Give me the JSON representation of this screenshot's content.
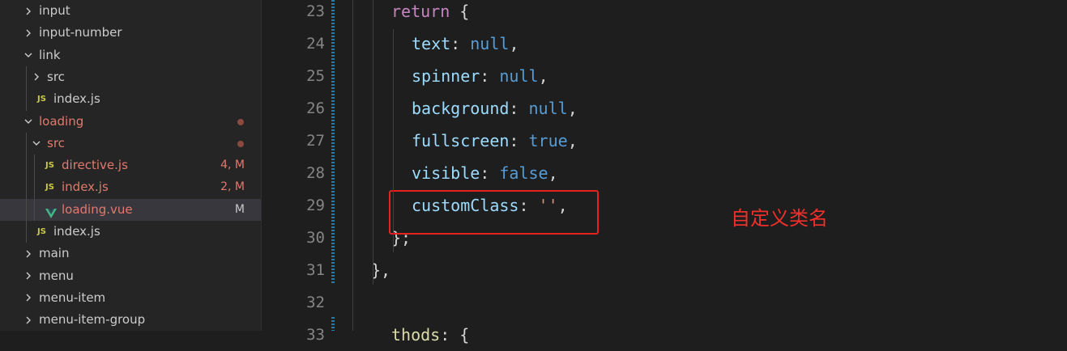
{
  "explorer": {
    "items": [
      {
        "label": "input",
        "kind": "folder",
        "state": "collapsed"
      },
      {
        "label": "input-number",
        "kind": "folder",
        "state": "collapsed"
      },
      {
        "label": "link",
        "kind": "folder",
        "state": "expanded"
      },
      {
        "label": "src",
        "kind": "folder",
        "state": "collapsed"
      },
      {
        "label": "index.js",
        "kind": "js"
      },
      {
        "label": "loading",
        "kind": "folder",
        "state": "expanded",
        "modified": true,
        "dot": true
      },
      {
        "label": "src",
        "kind": "folder",
        "state": "expanded",
        "modified": true,
        "dot": true
      },
      {
        "label": "directive.js",
        "kind": "js",
        "modified": true,
        "badge": "4, M"
      },
      {
        "label": "index.js",
        "kind": "js",
        "modified": true,
        "badge": "2, M"
      },
      {
        "label": "loading.vue",
        "kind": "vue",
        "modified": true,
        "badge": "M",
        "selected": true
      },
      {
        "label": "index.js",
        "kind": "js"
      },
      {
        "label": "main",
        "kind": "folder",
        "state": "collapsed"
      },
      {
        "label": "menu",
        "kind": "folder",
        "state": "collapsed"
      },
      {
        "label": "menu-item",
        "kind": "folder",
        "state": "collapsed"
      },
      {
        "label": "menu-item-group",
        "kind": "folder",
        "state": "collapsed"
      }
    ],
    "js_icon_text": "JS"
  },
  "editor": {
    "line_numbers": [
      "23",
      "24",
      "25",
      "26",
      "27",
      "28",
      "29",
      "30",
      "31",
      "32",
      "33"
    ],
    "lines": [
      [
        {
          "t": "return",
          "c": "keyword"
        },
        {
          "t": " {",
          "c": "punct"
        }
      ],
      [
        {
          "t": "text",
          "c": "prop"
        },
        {
          "t": ": ",
          "c": "punct"
        },
        {
          "t": "null",
          "c": "const"
        },
        {
          "t": ",",
          "c": "punct"
        }
      ],
      [
        {
          "t": "spinner",
          "c": "prop"
        },
        {
          "t": ": ",
          "c": "punct"
        },
        {
          "t": "null",
          "c": "const"
        },
        {
          "t": ",",
          "c": "punct"
        }
      ],
      [
        {
          "t": "background",
          "c": "prop"
        },
        {
          "t": ": ",
          "c": "punct"
        },
        {
          "t": "null",
          "c": "const"
        },
        {
          "t": ",",
          "c": "punct"
        }
      ],
      [
        {
          "t": "fullscreen",
          "c": "prop"
        },
        {
          "t": ": ",
          "c": "punct"
        },
        {
          "t": "true",
          "c": "const"
        },
        {
          "t": ",",
          "c": "punct"
        }
      ],
      [
        {
          "t": "visible",
          "c": "prop"
        },
        {
          "t": ": ",
          "c": "punct"
        },
        {
          "t": "false",
          "c": "const"
        },
        {
          "t": ",",
          "c": "punct"
        }
      ],
      [
        {
          "t": "customClass",
          "c": "prop"
        },
        {
          "t": ": ",
          "c": "punct"
        },
        {
          "t": "''",
          "c": "string"
        },
        {
          "t": ",",
          "c": "punct"
        }
      ],
      [
        {
          "t": "};",
          "c": "punct"
        }
      ],
      [
        {
          "t": "},",
          "c": "punct"
        }
      ],
      [],
      [
        {
          "t": "thods",
          "c": "fn"
        },
        {
          "t": ": {",
          "c": "punct"
        }
      ]
    ]
  },
  "annotation": {
    "text": "自定义类名",
    "color": "#f0302a"
  },
  "colors": {
    "sidebar_bg": "#252526",
    "editor_bg": "#1e1e1e",
    "modified": "#e2796c",
    "js_yellow": "#cbcb41",
    "vue_green": "#41b883",
    "highlight_red": "#e8231e"
  }
}
